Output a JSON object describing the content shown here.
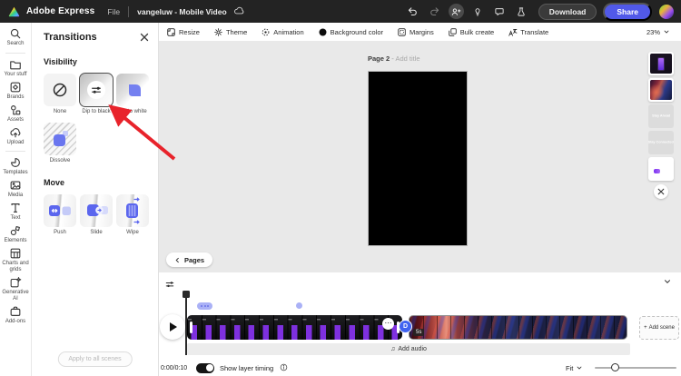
{
  "topbar": {
    "app_name": "Adobe Express",
    "menu_file": "File",
    "doc_title": "vangeluw - Mobile Video",
    "download": "Download",
    "share": "Share"
  },
  "sidebar": {
    "items": [
      "Search",
      "Your stuff",
      "Brands",
      "Assets",
      "Upload",
      "Templates",
      "Media",
      "Text",
      "Elements",
      "Charts and grids",
      "Generative AI",
      "Add-ons"
    ]
  },
  "panel": {
    "title": "Transitions",
    "section_visibility": "Visibility",
    "section_move": "Move",
    "tiles": {
      "none": "None",
      "dip_black": "Dip to black",
      "dip_white": "Dip to white",
      "dissolve": "Dissolve",
      "push": "Push",
      "slide": "Slide",
      "wipe": "Wipe"
    },
    "selected_tile": "Dip to black",
    "apply_all": "Apply to all scenes"
  },
  "doc_toolbar": {
    "items": [
      "Resize",
      "Theme",
      "Animation",
      "Background color",
      "Margins",
      "Bulk create",
      "Translate"
    ],
    "zoom": "23%"
  },
  "canvas": {
    "page_label": "Page 2",
    "separator": "-",
    "title_placeholder": "Add title",
    "pages_button": "Pages"
  },
  "pages_rail": {
    "thumb3_text": "Stay Ahead",
    "thumb4_text": "Stay Connected"
  },
  "timeline": {
    "time": "0:00/0:10",
    "layer_timing": "Show layer timing",
    "add_audio": "Add audio",
    "add_scene": "Add scene",
    "plus": "+",
    "duration_badge": "5s",
    "transition_badge": "D",
    "fit": "Fit",
    "music_icon": "♫"
  },
  "colors": {
    "topbar_bg": "#232323",
    "accent_blue": "#5159e8",
    "tile_blue": "#5b66ee",
    "arrow_red": "#e8232b",
    "canvas_bg": "#e9e9e9"
  }
}
